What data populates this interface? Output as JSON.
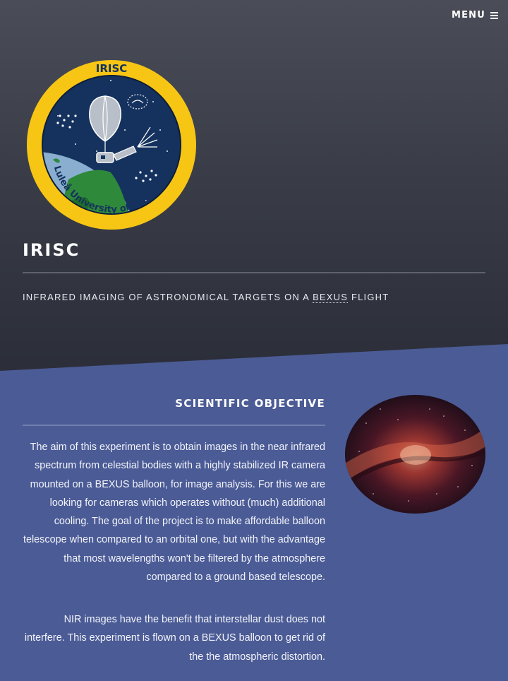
{
  "header": {
    "menu_label": "MENU",
    "menu_icon": "hamburger-icon",
    "logo": {
      "top_text": "IRISC",
      "ring_text": "Luleå University of Technology",
      "ring_color": "#f7c614",
      "disc_color": "#15325e"
    },
    "title": "IRISC",
    "subtitle_before": "INFRARED IMAGING OF ASTRONOMICAL TARGETS ON A ",
    "subtitle_abbr": "BEXUS",
    "subtitle_after": " FLIGHT"
  },
  "section": {
    "title": "SCIENTIFIC OBJECTIVE",
    "paragraphs": [
      "The aim of this experiment is to obtain images in the near infrared spectrum from celestial bodies with a highly stabilized IR camera mounted on a BEXUS balloon, for image analysis. For this we are looking for cameras which operates without (much) additional cooling. The goal of the project is to make affordable balloon telescope when compared to an orbital one, but with the advantage that most wavelengths won't be filtered by the atmosphere compared to a ground based telescope.",
      "NIR images have the benefit that interstellar dust does not interfere. This experiment is flown on a BEXUS balloon to get rid of the the atmospheric distortion."
    ],
    "image": "milky-way-infrared-image"
  },
  "colors": {
    "hero_top": "#4a4d57",
    "hero_bottom": "#2b2e39",
    "section_bg": "#4b5b96"
  }
}
